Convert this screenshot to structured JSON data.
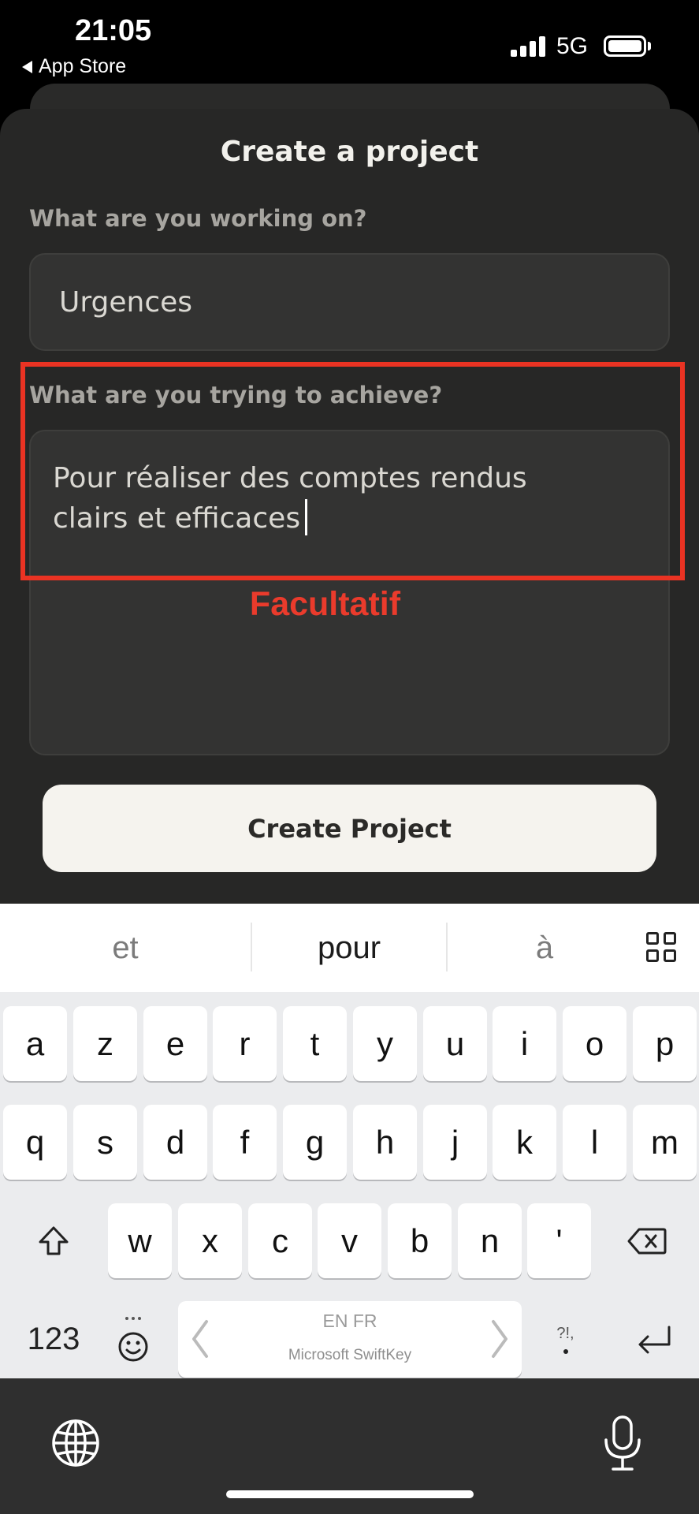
{
  "status_bar": {
    "time": "21:05",
    "back_label": "App Store",
    "network": "5G",
    "signal_bars": 4,
    "battery_level": 1.0
  },
  "sheet": {
    "title": "Create a project",
    "name_label": "What are you working on?",
    "name_value": "Urgences",
    "goal_label": "What are you trying to achieve?",
    "goal_value_line1": "Pour réaliser des comptes rendus",
    "goal_value_line2": "clairs et efficaces",
    "optional_annotation": "Facultatif",
    "create_button": "Create Project"
  },
  "keyboard": {
    "suggestions": [
      "et",
      "pour",
      "à"
    ],
    "row1": [
      "a",
      "z",
      "e",
      "r",
      "t",
      "y",
      "u",
      "i",
      "o",
      "p"
    ],
    "row2": [
      "q",
      "s",
      "d",
      "f",
      "g",
      "h",
      "j",
      "k",
      "l",
      "m"
    ],
    "row3": [
      "w",
      "x",
      "c",
      "v",
      "b",
      "n",
      "'"
    ],
    "numbers_key": "123",
    "space_languages": "EN FR",
    "space_brand": "Microsoft SwiftKey",
    "punct_key": "?!,",
    "icons": [
      "grid-icon",
      "shift-icon",
      "backspace-icon",
      "emoji-icon",
      "return-icon",
      "globe-icon",
      "microphone-icon"
    ]
  },
  "colors": {
    "sheet_bg": "#272726",
    "field_bg": "#333332",
    "annotation_red": "#ea3323",
    "button_bg": "#f5f3ee"
  }
}
